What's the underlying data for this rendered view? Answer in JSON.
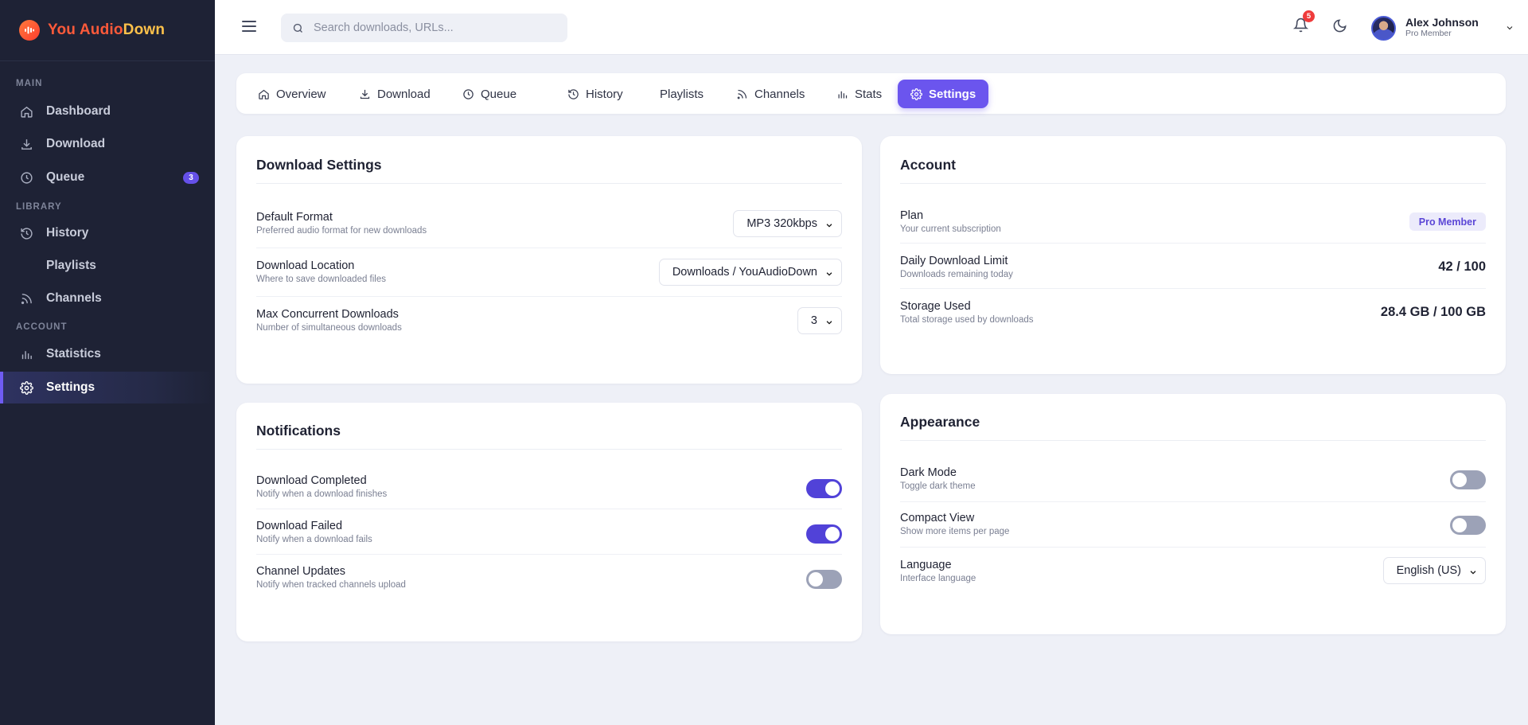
{
  "brand": {
    "name_part1": "You Audio",
    "name_part2": "Down"
  },
  "sidebar": {
    "sections": [
      "MAIN",
      "LIBRARY",
      "ACCOUNT"
    ],
    "items": [
      {
        "label": "Dashboard",
        "icon": "home-icon"
      },
      {
        "label": "Download",
        "icon": "download-icon"
      },
      {
        "label": "Queue",
        "icon": "clock-icon",
        "badge": "3"
      },
      {
        "label": "History",
        "icon": "history-icon"
      },
      {
        "label": "Playlists",
        "icon": ""
      },
      {
        "label": "Channels",
        "icon": "rss-icon"
      },
      {
        "label": "Statistics",
        "icon": "bar-chart-icon"
      },
      {
        "label": "Settings",
        "icon": "gear-icon",
        "active": true
      }
    ]
  },
  "topbar": {
    "search_placeholder": "Search downloads, URLs...",
    "notification_count": "5",
    "user": {
      "name": "Alex Johnson",
      "role": "Pro Member"
    }
  },
  "tabs": [
    {
      "label": "Overview",
      "icon": "home-icon"
    },
    {
      "label": "Download",
      "icon": "download-icon"
    },
    {
      "label": "Queue",
      "icon": "clock-icon"
    },
    {
      "label": "History",
      "icon": "history-icon"
    },
    {
      "label": "Playlists",
      "icon": ""
    },
    {
      "label": "Channels",
      "icon": "rss-icon"
    },
    {
      "label": "Stats",
      "icon": "bar-chart-icon"
    },
    {
      "label": "Settings",
      "icon": "gear-icon",
      "active": true
    }
  ],
  "download_settings": {
    "title": "Download Settings",
    "rows": [
      {
        "label": "Default Format",
        "desc": "Preferred audio format for new downloads",
        "value": "MP3 320kbps"
      },
      {
        "label": "Download Location",
        "desc": "Where to save downloaded files",
        "value": "Downloads / YouAudioDown"
      },
      {
        "label": "Max Concurrent Downloads",
        "desc": "Number of simultaneous downloads",
        "value": "3"
      }
    ]
  },
  "notifications": {
    "title": "Notifications",
    "rows": [
      {
        "label": "Download Completed",
        "desc": "Notify when a download finishes",
        "on": true
      },
      {
        "label": "Download Failed",
        "desc": "Notify when a download fails",
        "on": true
      },
      {
        "label": "Channel Updates",
        "desc": "Notify when tracked channels upload",
        "on": false
      }
    ]
  },
  "account": {
    "title": "Account",
    "rows": [
      {
        "label": "Plan",
        "desc": "Your current subscription",
        "value": "Pro Member"
      },
      {
        "label": "Daily Download Limit",
        "desc": "Downloads remaining today",
        "value": "42 / 100"
      },
      {
        "label": "Storage Used",
        "desc": "Total storage used by downloads",
        "value": "28.4 GB / 100 GB"
      }
    ]
  },
  "appearance": {
    "title": "Appearance",
    "rows": [
      {
        "label": "Dark Mode",
        "desc": "Toggle dark theme",
        "on": false
      },
      {
        "label": "Compact View",
        "desc": "Show more items per page",
        "on": false
      },
      {
        "label": "Language",
        "desc": "Interface language",
        "value": "English (US)"
      }
    ]
  },
  "colors": {
    "accent": "#6b55ee",
    "sidebar_bg": "#1e2235",
    "toggle_on": "#5142d8",
    "toggle_off": "#9ca2b7",
    "badge_red": "#ef3b3b"
  }
}
